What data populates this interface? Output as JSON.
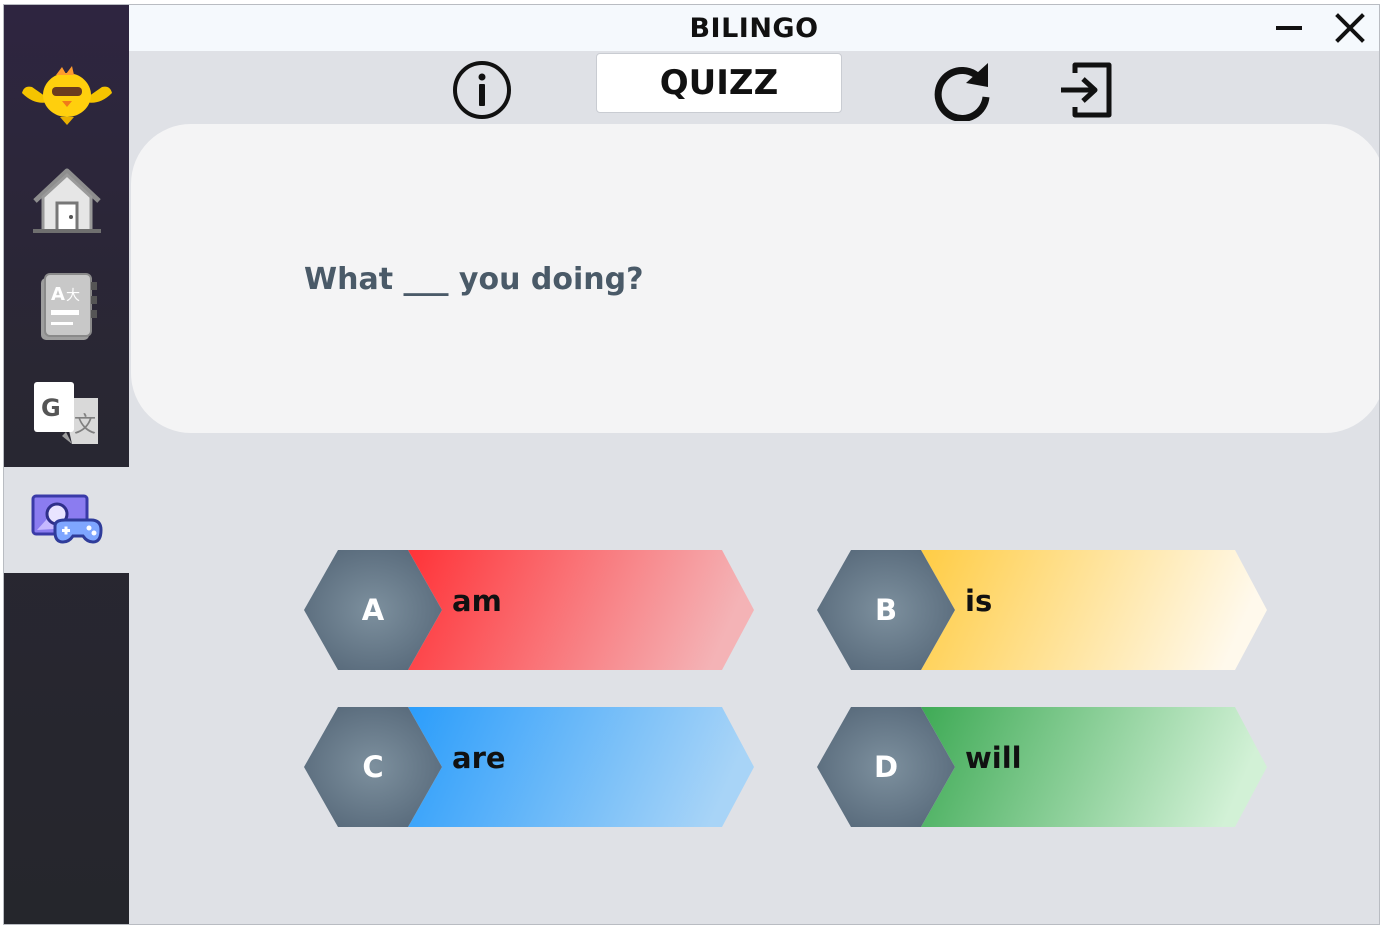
{
  "app": {
    "title": "BILINGO"
  },
  "window_controls": {
    "minimize_icon": "minimize-icon",
    "close_icon": "close-icon"
  },
  "sidebar": {
    "logo_icon": "bird-mascot-icon",
    "items": [
      {
        "icon": "home-icon",
        "active": false
      },
      {
        "icon": "dictionary-icon",
        "active": false
      },
      {
        "icon": "translate-icon",
        "active": false
      },
      {
        "icon": "game-icon",
        "active": true
      }
    ]
  },
  "toolbar": {
    "tab_label": "QUIZZ",
    "info_icon": "info-icon",
    "refresh_icon": "refresh-icon",
    "exit_icon": "exit-icon"
  },
  "question": {
    "text": "What ___ you doing?"
  },
  "answers": [
    {
      "letter": "A",
      "text": "am",
      "color_start": "#ff3338",
      "color_end": "#f4b3b6"
    },
    {
      "letter": "B",
      "text": "is",
      "color_start": "#ffcc44",
      "color_end": "#fff9ec"
    },
    {
      "letter": "C",
      "text": "are",
      "color_start": "#2b9dfb",
      "color_end": "#a8d4f7"
    },
    {
      "letter": "D",
      "text": "will",
      "color_start": "#3eaa55",
      "color_end": "#d2f1d6"
    }
  ],
  "colors": {
    "hex_badge": "#627584",
    "question_text": "#4a5a68",
    "sidebar": "#2a2735"
  }
}
